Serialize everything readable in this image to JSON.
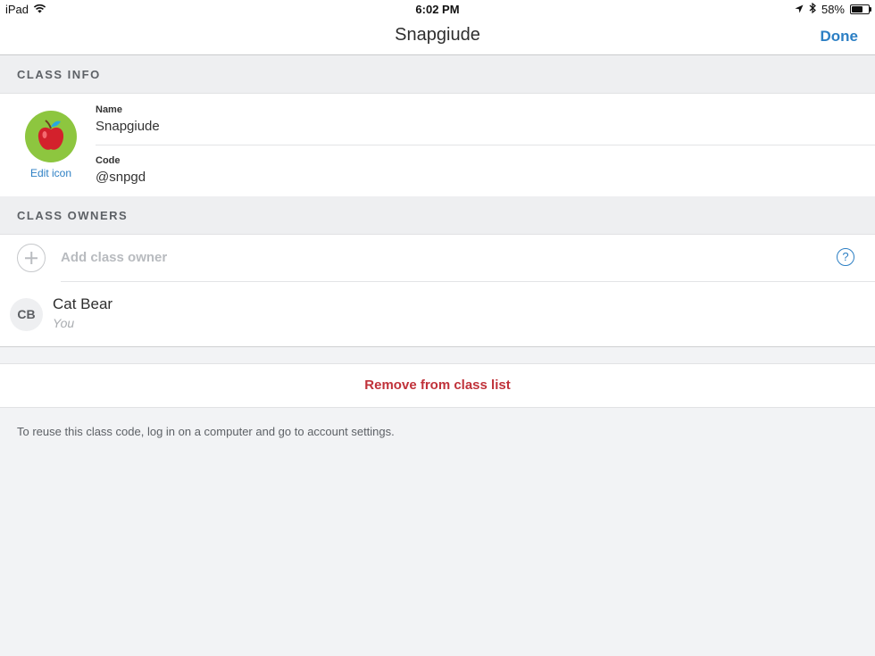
{
  "status_bar": {
    "device": "iPad",
    "time": "6:02 PM",
    "battery": "58%",
    "battery_level": 0.58
  },
  "nav": {
    "title": "Snapgiude",
    "done_label": "Done"
  },
  "class_info": {
    "header": "CLASS INFO",
    "edit_icon_label": "Edit icon",
    "name_label": "Name",
    "name_value": "Snapgiude",
    "code_label": "Code",
    "code_value": "@snpgd"
  },
  "class_owners": {
    "header": "CLASS OWNERS",
    "add_label": "Add class owner",
    "owners": [
      {
        "initials": "CB",
        "name": "Cat Bear",
        "subtitle": "You"
      }
    ]
  },
  "remove": {
    "label": "Remove from class list"
  },
  "footnote": "To reuse this class code, log in on a computer and go to account settings.",
  "colors": {
    "accent": "#2c7fc4",
    "danger": "#c0323a",
    "apple_bg": "#8dc63f",
    "background": "#f2f3f5"
  }
}
